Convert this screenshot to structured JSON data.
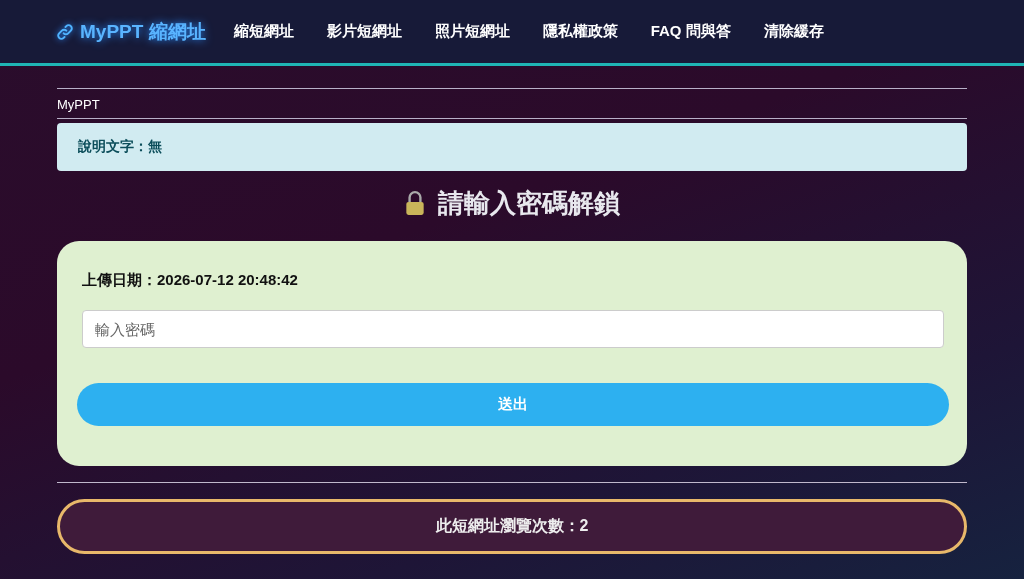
{
  "nav": {
    "brand": "MyPPT 縮網址",
    "links": [
      "縮短網址",
      "影片短網址",
      "照片短網址",
      "隱私權政策",
      "FAQ 問與答",
      "清除緩存"
    ]
  },
  "breadcrumb": "MyPPT",
  "description": "說明文字：無",
  "heading": "請輸入密碼解鎖",
  "card": {
    "upload_date": "上傳日期：2026-07-12 20:48:42",
    "password": {
      "placeholder": "輸入密碼"
    },
    "submit": "送出"
  },
  "views": "此短網址瀏覽次數：2"
}
